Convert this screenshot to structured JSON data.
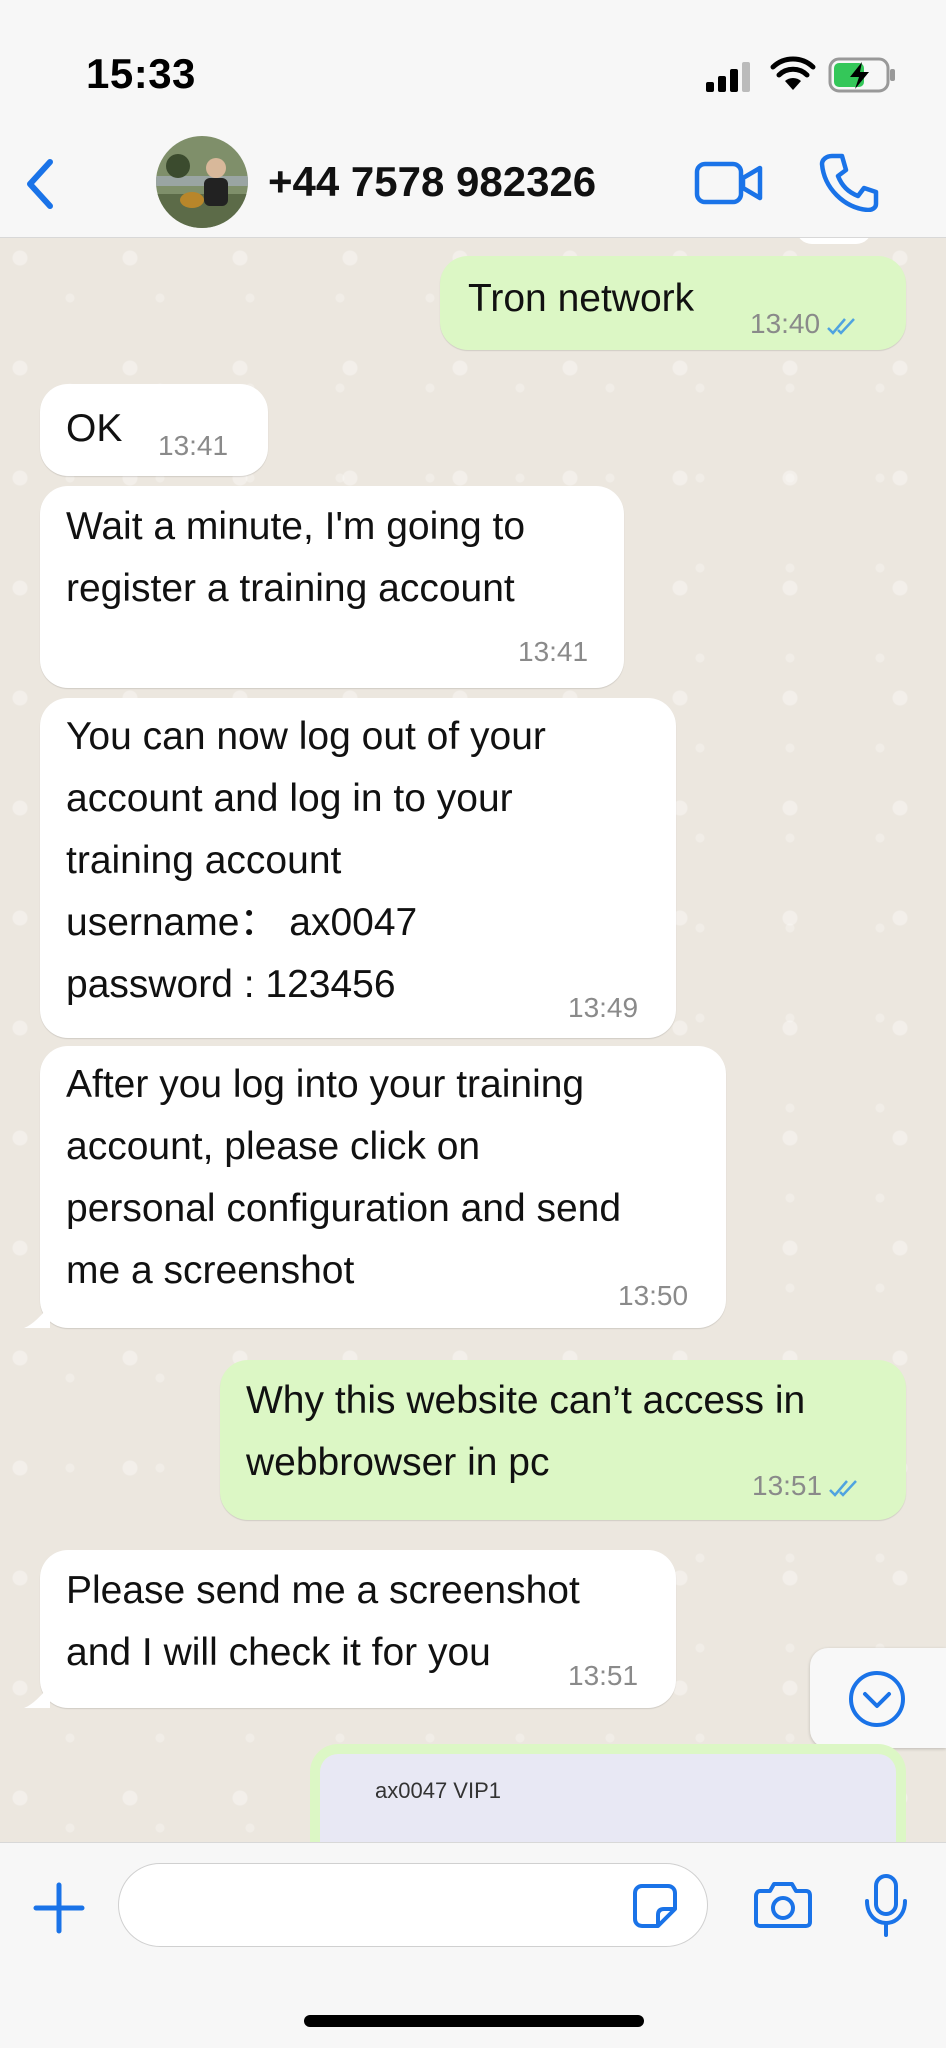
{
  "status_bar": {
    "time": "15:33"
  },
  "header": {
    "contact": "+44 7578 982326"
  },
  "messages": [
    {
      "dir": "out",
      "text": "Tron network",
      "time": "13:40",
      "read": true
    },
    {
      "dir": "in",
      "text": "OK",
      "time": "13:41"
    },
    {
      "dir": "in",
      "text": "Wait a minute, I'm going to\nregister a training account",
      "time": "13:41"
    },
    {
      "dir": "in",
      "text": "You can now log out of your\naccount and log in to your\ntraining account\nusername： ax0047\npassword : 123456",
      "time": "13:49"
    },
    {
      "dir": "in",
      "text": "After you log into your training\naccount, please click on\npersonal configuration and send\nme a screenshot",
      "time": "13:50"
    },
    {
      "dir": "out",
      "text": "Why this website can’t access in\nwebbrowser in pc",
      "time": "13:51",
      "read": true
    },
    {
      "dir": "in",
      "text": "Please send me a screenshot\nand I will check it for you",
      "time": "13:51"
    }
  ],
  "image_message": {
    "caption": "ax0047  VIP1"
  },
  "input": {
    "placeholder": ""
  },
  "colors": {
    "accent": "#1a73e8",
    "outgoing": "#dcf7c5",
    "incoming": "#ffffff",
    "read_ticks": "#4fa3e0"
  },
  "icons": [
    "back-icon",
    "video-call-icon",
    "phone-icon",
    "plus-icon",
    "sticker-icon",
    "camera-icon",
    "microphone-icon",
    "chevron-down-icon"
  ]
}
